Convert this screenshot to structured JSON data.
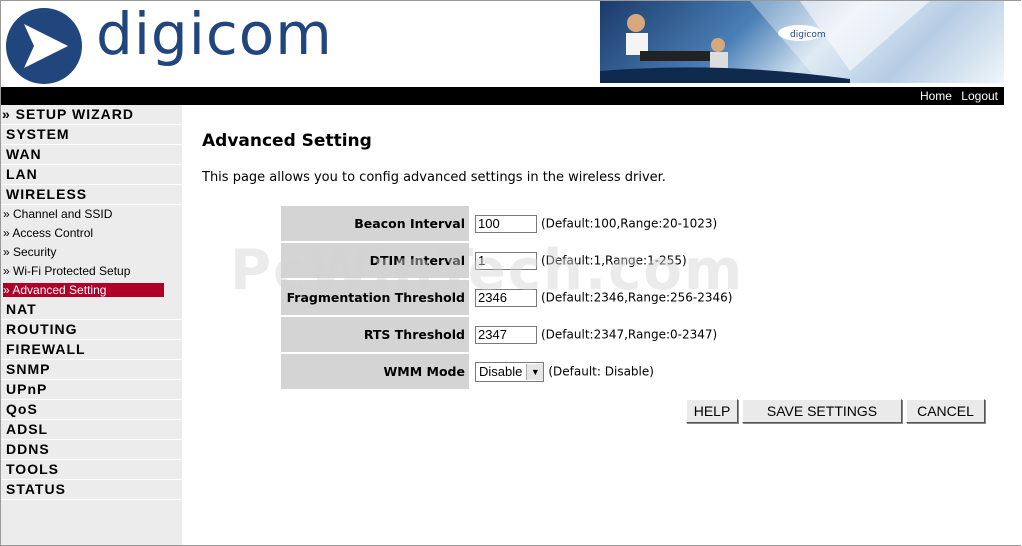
{
  "header": {
    "brand": "digicom",
    "links": {
      "home": "Home",
      "logout": "Logout"
    }
  },
  "sidebar": {
    "wizard": "» SETUP WIZARD",
    "groups_top": [
      "SYSTEM",
      "WAN",
      "LAN",
      "WIRELESS"
    ],
    "wireless_sub": [
      "» Channel and SSID",
      "» Access Control",
      "» Security",
      "» Wi-Fi Protected Setup",
      "» Advanced Setting"
    ],
    "groups_bottom": [
      "NAT",
      "ROUTING",
      "FIREWALL",
      "SNMP",
      "UPnP",
      "QoS",
      "ADSL",
      "DDNS",
      "TOOLS",
      "STATUS"
    ]
  },
  "main": {
    "title": "Advanced Setting",
    "description": "This page allows you to config advanced settings in the wireless driver.",
    "fields": [
      {
        "label": "Beacon Interval",
        "value": "100",
        "hint": "(Default:100,Range:20-1023)"
      },
      {
        "label": "DTIM Interval",
        "value": "1",
        "hint": "(Default:1,Range:1-255)"
      },
      {
        "label": "Fragmentation Threshold",
        "value": "2346",
        "hint": "(Default:2346,Range:256-2346)"
      },
      {
        "label": "RTS Threshold",
        "value": "2347",
        "hint": "(Default:2347,Range:0-2347)"
      }
    ],
    "wmm": {
      "label": "WMM Mode",
      "selected": "Disable",
      "hint": "(Default: Disable)"
    },
    "buttons": {
      "help": "HELP",
      "save": "SAVE SETTINGS",
      "cancel": "CANCEL"
    }
  },
  "watermark": "PcWinTech.com",
  "colors": {
    "brand_blue": "#21467e",
    "active_nav": "#b0002a",
    "sidebar_bg": "#ececec",
    "label_bg": "#d4d4d4"
  }
}
